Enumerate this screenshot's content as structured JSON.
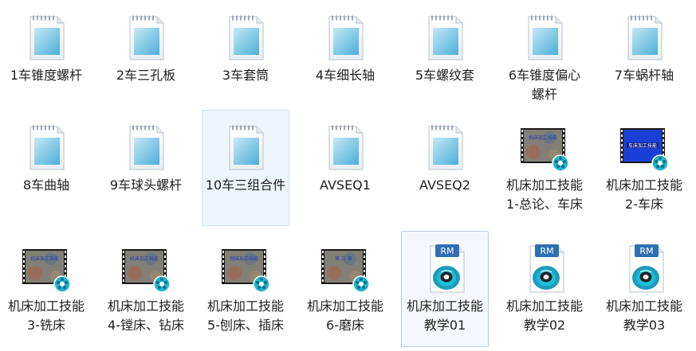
{
  "files": [
    {
      "label": "1车锥度螺杆",
      "icon": "notepad-icon"
    },
    {
      "label": "2车三孔板",
      "icon": "notepad-icon"
    },
    {
      "label": "3车套筒",
      "icon": "notepad-icon"
    },
    {
      "label": "4车细长轴",
      "icon": "notepad-icon"
    },
    {
      "label": "5车螺纹套",
      "icon": "notepad-icon"
    },
    {
      "label": "6车锥度偏心螺杆",
      "icon": "notepad-icon"
    },
    {
      "label": "7车蜗杆轴",
      "icon": "notepad-icon"
    },
    {
      "label": "8车曲轴",
      "icon": "notepad-icon"
    },
    {
      "label": "9车球头螺杆",
      "icon": "notepad-icon"
    },
    {
      "label": "10车三组合件",
      "icon": "notepad-icon",
      "state": "hover"
    },
    {
      "label": "AVSEQ1",
      "icon": "notepad-icon"
    },
    {
      "label": "AVSEQ2",
      "icon": "notepad-icon"
    },
    {
      "label": "机床加工技能1-总论、车床",
      "icon": "video-thumbnail-icon",
      "thumb_text": "机床加工技能"
    },
    {
      "label": "机床加工技能2-车床",
      "icon": "video-thumbnail-blue-icon",
      "thumb_text": "车床加工技能"
    },
    {
      "label": "机床加工技能3-铣床",
      "icon": "video-thumbnail-icon",
      "thumb_text": "机床加工技能"
    },
    {
      "label": "机床加工技能4-镗床、钻床",
      "icon": "video-thumbnail-icon",
      "thumb_text": "机床加工技能"
    },
    {
      "label": "机床加工技能5-刨床、插床",
      "icon": "video-thumbnail-icon",
      "thumb_text": "刨床加工技能"
    },
    {
      "label": "机床加工技能6-磨床",
      "icon": "video-thumbnail-icon",
      "thumb_text": "第 三 章"
    },
    {
      "label": "机床加工技能教学01",
      "icon": "realmedia-file-icon",
      "badge": "RM",
      "state": "selected"
    },
    {
      "label": "机床加工技能教学02",
      "icon": "realmedia-file-icon",
      "badge": "RM"
    },
    {
      "label": "机床加工技能教学03",
      "icon": "realmedia-file-icon",
      "badge": "RM"
    }
  ],
  "colors": {
    "hover_bg": "#eef5fb",
    "selected_border": "#b6cde2",
    "rm_badge": "#2f6fb3",
    "video_blue": "#1a3fd6",
    "teal_reel": "#1fb5d0"
  }
}
